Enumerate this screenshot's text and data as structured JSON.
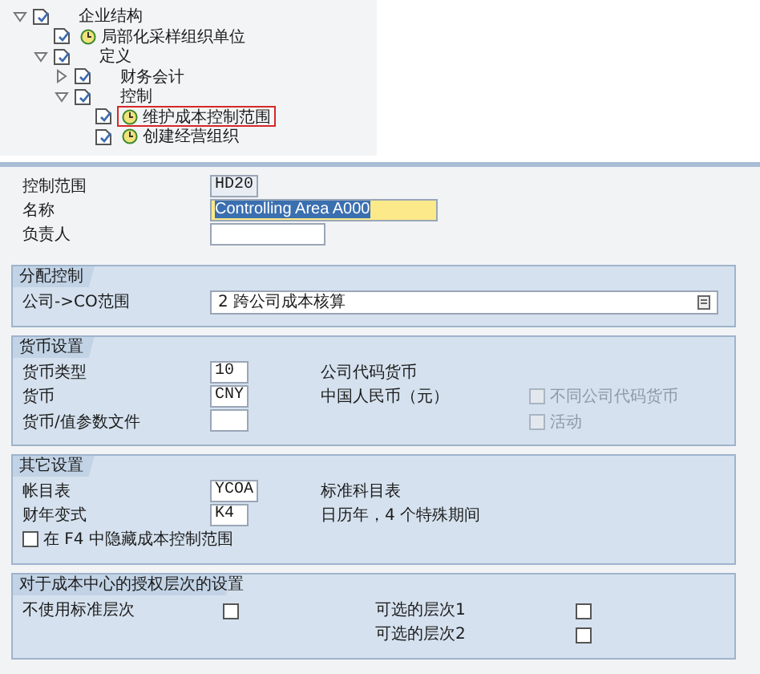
{
  "tree": [
    {
      "label": "企业结构",
      "kind": "folder",
      "expanded": true,
      "marked": false,
      "children": [
        {
          "label": "局部化采样组织单位",
          "kind": "activity",
          "marked": false
        },
        {
          "label": "定义",
          "kind": "folder",
          "expanded": true,
          "marked": false,
          "children": [
            {
              "label": "财务会计",
              "kind": "folder",
              "expanded": false,
              "marked": false
            },
            {
              "label": "控制",
              "kind": "folder",
              "expanded": true,
              "marked": false,
              "children": [
                {
                  "label": "维护成本控制范围",
                  "kind": "activity",
                  "marked": true
                },
                {
                  "label": "创建经营组织",
                  "kind": "activity",
                  "marked": false
                }
              ]
            }
          ]
        }
      ]
    }
  ],
  "header_fields": [
    {
      "label": "控制范围",
      "value": "HD20",
      "kind": "display"
    },
    {
      "label": "名称",
      "value": "Controlling Area A000",
      "kind": "highlight"
    },
    {
      "label": "负责人",
      "kind": "input"
    }
  ],
  "sections": [
    {
      "title": "分配控制",
      "rows": [
        {
          "kind": "select",
          "label": "公司->CO范围",
          "value": "2 跨公司成本核算"
        }
      ]
    },
    {
      "title": "货币设置",
      "rows": [
        {
          "kind": "input",
          "label": "货币类型",
          "value": "10",
          "note": "公司代码货币"
        },
        {
          "kind": "input",
          "label": "货币",
          "value": "CNY",
          "note": "中国人民币（元）",
          "option": {
            "label": "不同公司代码货币",
            "checked": false,
            "disabled": true
          }
        },
        {
          "kind": "input",
          "label": "货币/值参数文件",
          "option": {
            "label": "活动",
            "checked": false,
            "disabled": true
          }
        }
      ]
    },
    {
      "title": "其它设置",
      "rows": [
        {
          "kind": "input",
          "label": "帐目表",
          "value": "YCOA",
          "note": "标准科目表"
        },
        {
          "kind": "input",
          "label": "财年变式",
          "value": "K4",
          "note": "日历年，4 个特殊期间"
        },
        {
          "kind": "check",
          "label": "在 F4 中隐藏成本控制范围",
          "checked": false
        }
      ]
    },
    {
      "title": "对于成本中心的授权层次的设置",
      "rows": [
        {
          "kind": "pair",
          "left": {
            "label": "不使用标准层次",
            "checked": false
          },
          "right": {
            "label": "可选的层次1",
            "checked": false
          }
        },
        {
          "kind": "pair",
          "right": {
            "label": "可选的层次2",
            "checked": false
          }
        }
      ]
    }
  ]
}
